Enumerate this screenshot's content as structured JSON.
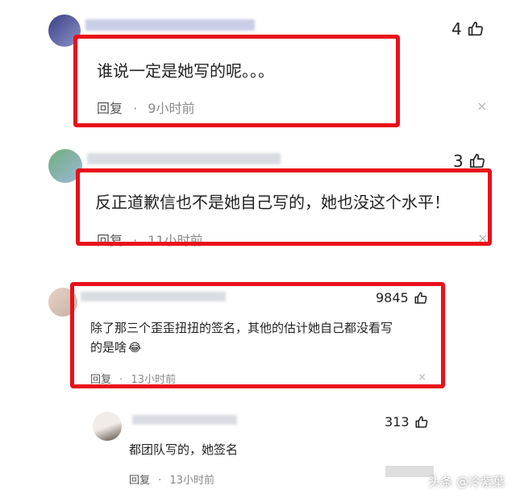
{
  "comments": [
    {
      "text": "谁说一定是她写的呢。。。",
      "reply_label": "回复",
      "dot": "·",
      "time": "9小时前",
      "likes": "4",
      "close": "×"
    },
    {
      "text": "反正道歉信也不是她自己写的，她也没这个水平！",
      "reply_label": "回复",
      "dot": "·",
      "time": "11小时前",
      "likes": "3",
      "close": "×"
    },
    {
      "text_line1": "除了那三个歪歪扭扭的签名，其他的估计她自己都没看写",
      "text_line2": "的是啥",
      "emoji": "😂",
      "reply_label": "回复",
      "dot": "·",
      "time": "13小时前",
      "likes": "9845",
      "close": "×"
    },
    {
      "text": "都团队写的，她签名",
      "reply_label": "回复",
      "dot": "·",
      "time": "13小时前",
      "likes": "313",
      "close": "×"
    }
  ],
  "watermark": {
    "text": "头条 @冷紫葉"
  },
  "colors": {
    "highlight_border": "#e8101a",
    "meta_text": "#8a8a8a",
    "background": "#ffffff"
  }
}
